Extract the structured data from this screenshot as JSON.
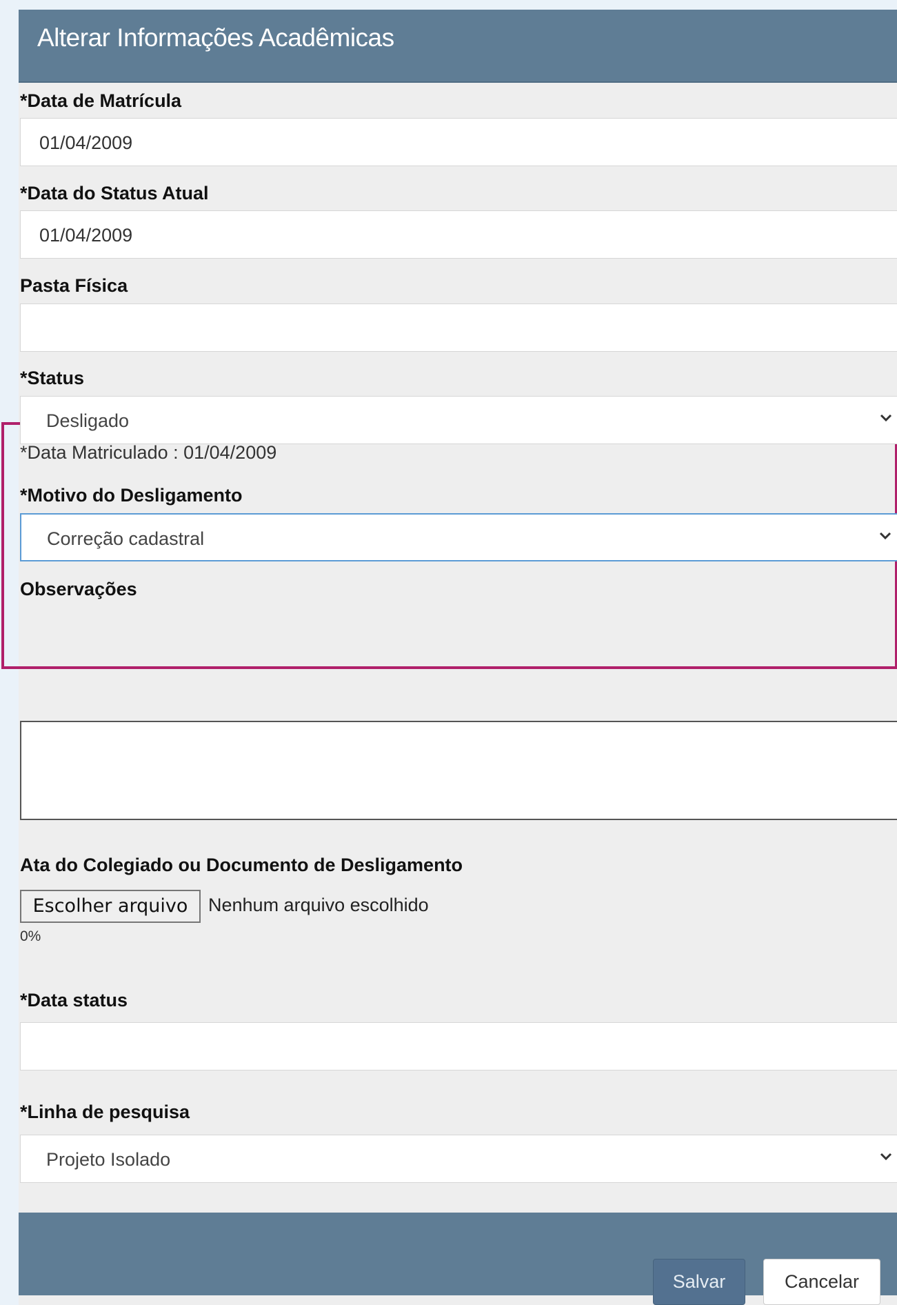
{
  "modal": {
    "title": "Alterar Informações Acadêmicas",
    "close_label": "×"
  },
  "fields": {
    "data_matricula": {
      "label": "*Data de Matrícula",
      "value": "01/04/2009"
    },
    "data_status_atual": {
      "label": "*Data do Status Atual",
      "value": "01/04/2009"
    },
    "pasta_fisica": {
      "label": "Pasta Física",
      "value": ""
    },
    "status": {
      "label": "*Status",
      "selected": "Desligado",
      "helper": "*Data Matriculado : 01/04/2009"
    },
    "motivo_desligamento": {
      "label": "*Motivo do Desligamento",
      "selected": "Correção cadastral"
    },
    "observacoes": {
      "label": "Observações",
      "value": ""
    },
    "ata": {
      "label": "Ata do Colegiado ou Documento de Desligamento",
      "button_label": "Escolher arquivo",
      "file_status": "Nenhum arquivo escolhido",
      "progress": "0%"
    },
    "data_status": {
      "label": "*Data status",
      "value": ""
    },
    "linha_pesquisa": {
      "label": "*Linha de pesquisa",
      "selected": "Projeto Isolado"
    }
  },
  "footer": {
    "save_label": "Salvar",
    "cancel_label": "Cancelar"
  },
  "colors": {
    "header": "#5f7d95",
    "highlight_border": "#b0206a",
    "save_button": "#537190"
  },
  "icons": [
    "close-icon",
    "chevron-down-icon"
  ]
}
